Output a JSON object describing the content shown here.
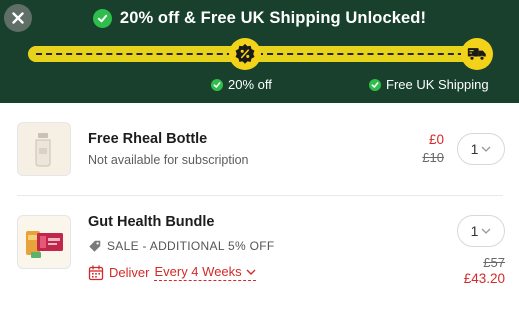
{
  "banner": {
    "headline": "20% off & Free UK Shipping Unlocked!",
    "progress": 1.0,
    "milestones": [
      {
        "icon": "percent-badge-icon",
        "label": "20% off",
        "achieved": true
      },
      {
        "icon": "delivery-truck-icon",
        "label": "Free UK Shipping",
        "achieved": true
      }
    ],
    "colors": {
      "background": "#18402d",
      "track": "#e7d21c",
      "milestone": "#f3d31a",
      "check": "#2fbe4b"
    }
  },
  "items": [
    {
      "name": "Free Rheal Bottle",
      "note": "Not available for subscription",
      "price_now": "£0",
      "price_was": "£10",
      "quantity": "1"
    },
    {
      "name": "Gut Health Bundle",
      "sale_label": "SALE - ADDITIONAL 5% OFF",
      "deliver_label": "Deliver",
      "frequency": "Every 4 Weeks",
      "price_was": "£57",
      "price_now": "£43.20",
      "quantity": "1"
    }
  ],
  "colors": {
    "sale_red": "#d42a2a"
  }
}
